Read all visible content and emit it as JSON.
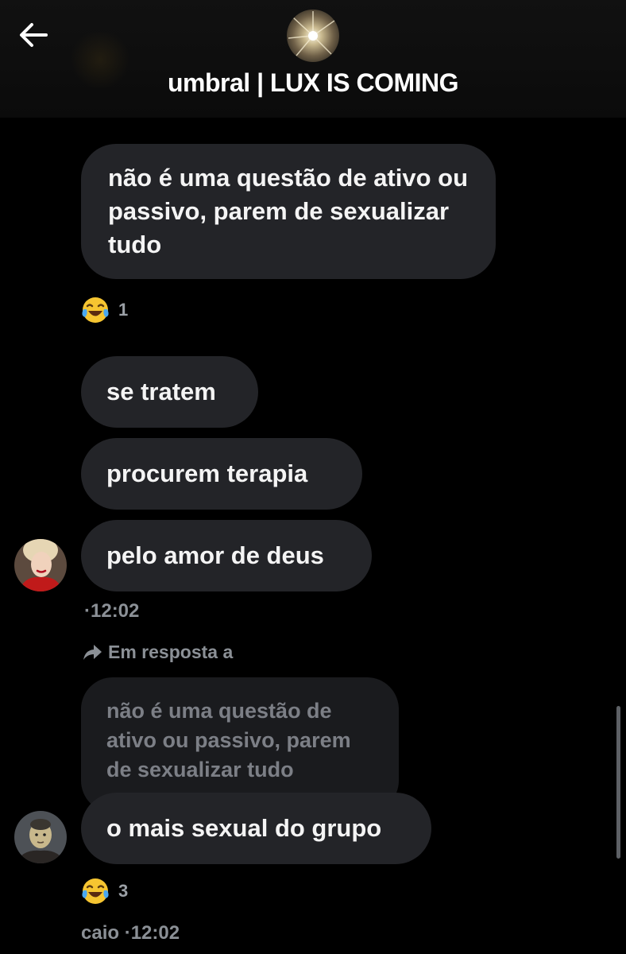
{
  "header": {
    "title": "umbral | LUX IS COMING",
    "back_icon": "arrow-left-icon"
  },
  "messages": [
    {
      "text": "não é uma questão de ativo ou passivo, parem de sexualizar tudo"
    },
    {
      "text": "se tratem"
    },
    {
      "text": "procurem terapia"
    },
    {
      "text": "pelo amor de deus"
    },
    {
      "text": "o mais sexual do grupo"
    }
  ],
  "reactions": [
    {
      "emoji": "😂",
      "count": "1"
    },
    {
      "emoji": "😂",
      "count": "3"
    }
  ],
  "meta": {
    "first_time": "·12:02",
    "reply_label": "Em resposta a",
    "quoted_text": "não é uma questão de ativo ou passivo, parem de sexualizar tudo",
    "last_sender": "caio",
    "last_time": "·12:02"
  },
  "colors": {
    "background": "#000000",
    "bubble": "#232428",
    "quoted_bubble": "#1a1b1e",
    "muted_text": "#8b9096"
  }
}
